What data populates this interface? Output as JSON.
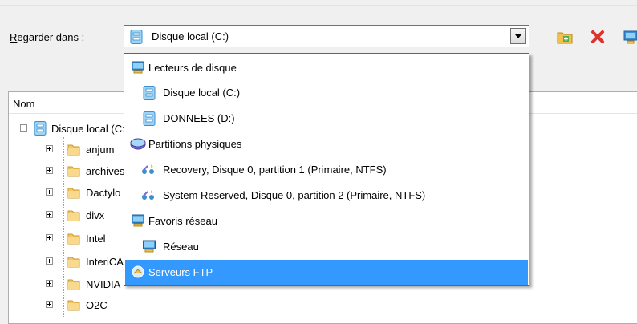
{
  "look_in": {
    "label_underlined": "R",
    "label_rest": "egarder dans :",
    "selected_value": "Disque local (C:)"
  },
  "toolbar": {
    "icons": [
      "new-folder-icon",
      "delete-icon",
      "network-drive-icon"
    ]
  },
  "tree": {
    "column_header": "Nom",
    "root_label": "Disque local (C:)",
    "folders": [
      "anjum",
      "archives",
      "Dactylo",
      "divx",
      "Intel",
      "InteriCAD",
      "NVIDIA",
      "O2C"
    ]
  },
  "dropdown": {
    "items": [
      {
        "label": "Lecteurs de disque",
        "icon": "computer-drives-icon"
      },
      {
        "label": "Disque local (C:)",
        "icon": "local-disk-icon"
      },
      {
        "label": "DONNEES (D:)",
        "icon": "local-disk-icon"
      },
      {
        "label": "Partitions physiques",
        "icon": "physical-partitions-icon"
      },
      {
        "label": "Recovery, Disque 0, partition 1 (Primaire, NTFS)",
        "icon": "partition-icon"
      },
      {
        "label": "System Reserved, Disque 0, partition 2 (Primaire, NTFS)",
        "icon": "partition-icon"
      },
      {
        "label": "Favoris réseau",
        "icon": "network-favorites-icon"
      },
      {
        "label": "Réseau",
        "icon": "network-icon"
      },
      {
        "label": "Serveurs FTP",
        "icon": "ftp-server-icon"
      }
    ],
    "selected_index": 8
  },
  "colors": {
    "selection": "#3399ff",
    "combo_border": "#3c7fb1"
  }
}
